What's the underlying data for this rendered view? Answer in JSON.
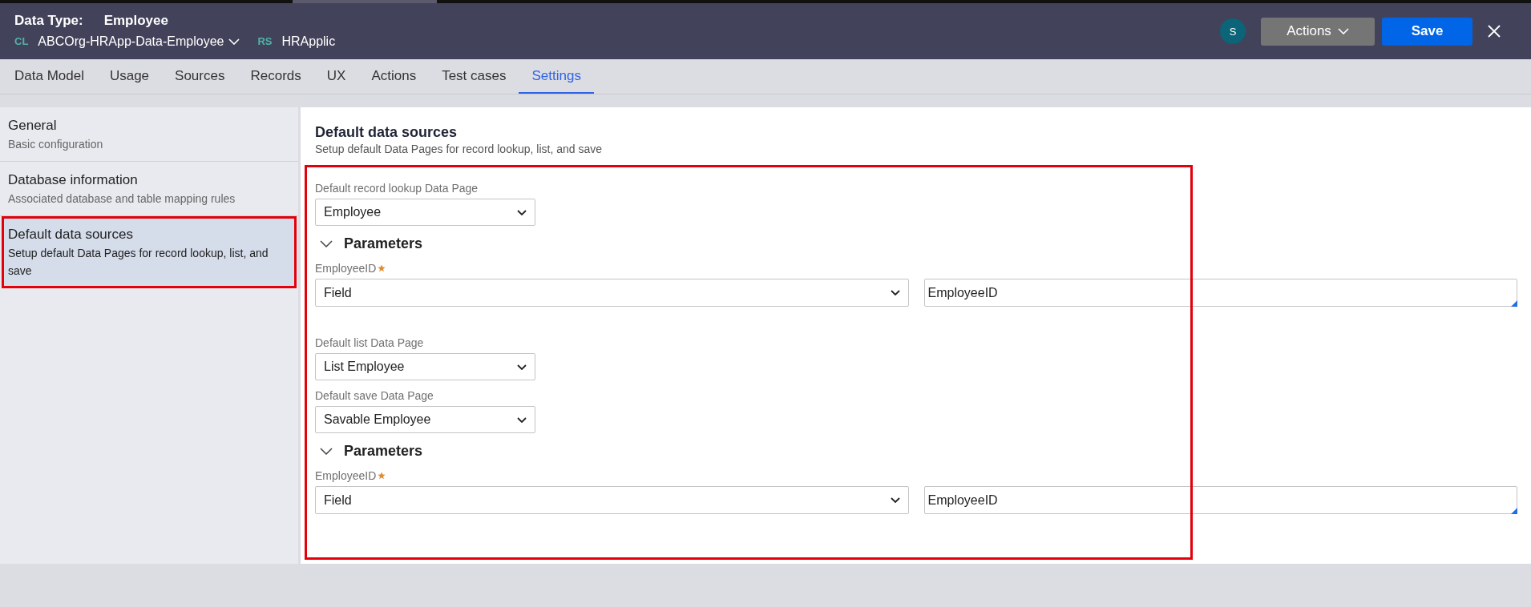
{
  "header": {
    "type_label": "Data Type:",
    "title": "Employee",
    "class_tag": "CL",
    "class_name": "ABCOrg-HRApp-Data-Employee",
    "ruleset_tag": "RS",
    "ruleset": "HRApplic",
    "avatar": "S",
    "actions_button": "Actions",
    "save_button": "Save"
  },
  "tabs": [
    {
      "label": "Data Model",
      "selected": false
    },
    {
      "label": "Usage",
      "selected": false
    },
    {
      "label": "Sources",
      "selected": false
    },
    {
      "label": "Records",
      "selected": false
    },
    {
      "label": "UX",
      "selected": false
    },
    {
      "label": "Actions",
      "selected": false
    },
    {
      "label": "Test cases",
      "selected": false
    },
    {
      "label": "Settings",
      "selected": true
    }
  ],
  "sidebar": {
    "items": [
      {
        "title": "General",
        "subtitle": "Basic configuration",
        "selected": false,
        "highlighted": false
      },
      {
        "title": "Database information",
        "subtitle": "Associated database and table mapping rules",
        "selected": false,
        "highlighted": false
      },
      {
        "title": "Default data sources",
        "subtitle": "Setup default Data Pages for record lookup, list, and save",
        "selected": true,
        "highlighted": true
      }
    ]
  },
  "panel": {
    "title": "Default data sources",
    "subtitle": "Setup default Data Pages for record lookup, list, and save",
    "highlighted": true,
    "fields": [
      {
        "kind": "select",
        "label": "Default record lookup Data Page",
        "value": "Employee"
      },
      {
        "kind": "parameters",
        "title": "Parameters",
        "expanded": true,
        "params": [
          {
            "label": "EmployeeID",
            "required": true,
            "source": "Field",
            "value": "EmployeeID"
          }
        ]
      },
      {
        "kind": "select",
        "label": "Default list Data Page",
        "value": "List Employee"
      },
      {
        "kind": "select",
        "label": "Default save Data Page",
        "value": "Savable Employee"
      },
      {
        "kind": "parameters",
        "title": "Parameters",
        "expanded": true,
        "params": [
          {
            "label": "EmployeeID",
            "required": true,
            "source": "Field",
            "value": "EmployeeID"
          }
        ]
      }
    ]
  }
}
